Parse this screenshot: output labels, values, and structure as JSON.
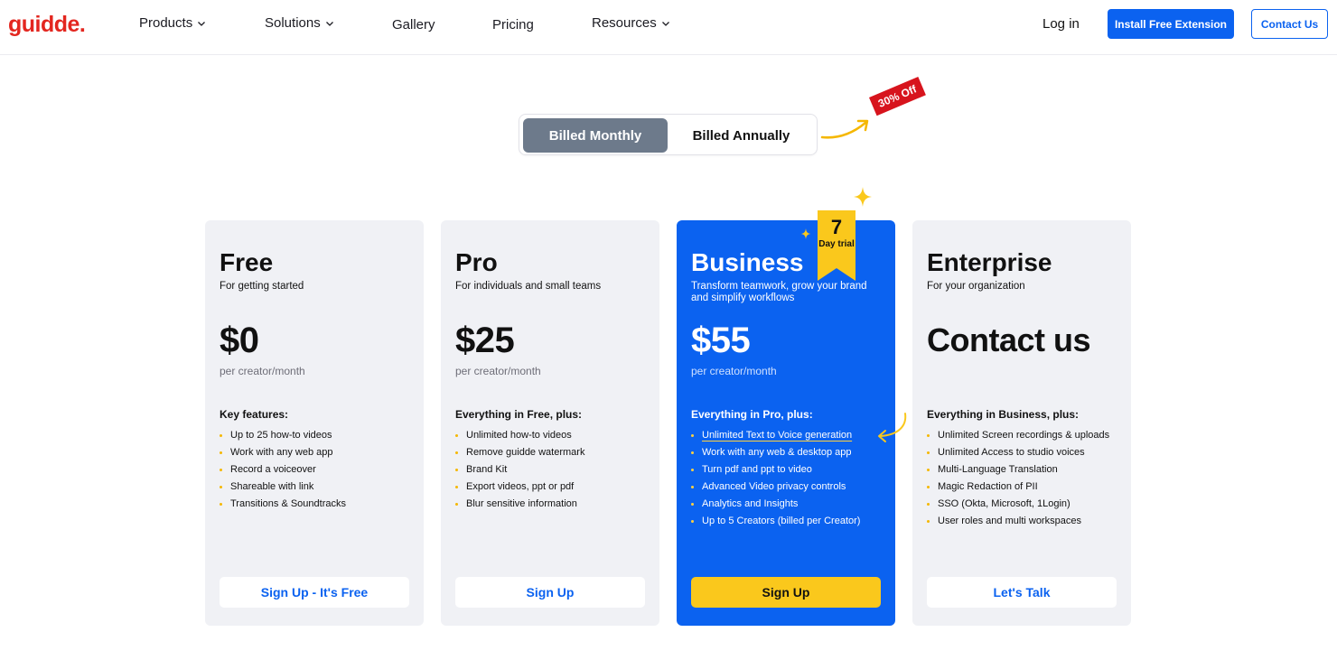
{
  "nav": {
    "logo": "guidde.",
    "items": [
      {
        "label": "Products",
        "dropdown": true
      },
      {
        "label": "Solutions",
        "dropdown": true
      },
      {
        "label": "Gallery",
        "dropdown": false
      },
      {
        "label": "Pricing",
        "dropdown": false
      },
      {
        "label": "Resources",
        "dropdown": true
      }
    ],
    "login": "Log in",
    "install": "Install Free Extension",
    "contact": "Contact Us"
  },
  "billing": {
    "monthly": "Billed Monthly",
    "annually": "Billed Annually",
    "selected": "monthly",
    "discount": "30% Off"
  },
  "plans": [
    {
      "name": "Free",
      "tagline": "For getting started",
      "price": "$0",
      "period": "per creator/month",
      "features_heading": "Key features:",
      "features": [
        "Up to 25 how-to videos",
        "Work with any web app",
        "Record a voiceover",
        "Shareable with link",
        "Transitions & Soundtracks"
      ],
      "cta": "Sign Up - It's Free"
    },
    {
      "name": "Pro",
      "tagline": "For individuals and small teams",
      "price": "$25",
      "period": "per creator/month",
      "features_heading": "Everything in Free, plus:",
      "features": [
        "Unlimited how-to videos",
        "Remove guidde watermark",
        "Brand Kit",
        "Export videos, ppt or pdf",
        "Blur sensitive information"
      ],
      "cta": "Sign Up"
    },
    {
      "name": "Business",
      "tagline": "Transform teamwork, grow your brand and simplify workflows",
      "price": "$55",
      "period": "per creator/month",
      "features_heading": "Everything in Pro, plus:",
      "features": [
        "Unlimited Text to Voice generation",
        "Work with any web & desktop app",
        "Turn pdf and ppt to video",
        "Advanced Video privacy controls",
        "Analytics and Insights",
        "Up to 5 Creators (billed per Creator)"
      ],
      "cta": "Sign Up",
      "trial_number": "7",
      "trial_label": "Day trial"
    },
    {
      "name": "Enterprise",
      "tagline": "For your organization",
      "price": "Contact us",
      "period": "",
      "features_heading": "Everything in Business, plus:",
      "features": [
        "Unlimited Screen recordings & uploads",
        "Unlimited Access to studio voices",
        "Multi-Language Translation",
        "Magic Redaction of PII",
        "SSO (Okta, Microsoft, 1Login)",
        "User roles and multi workspaces"
      ],
      "cta": "Let's Talk"
    }
  ],
  "colors": {
    "brand_red": "#e3261f",
    "primary_blue": "#0b62f0",
    "accent_yellow": "#fac81c",
    "toggle_active": "#6d7a8b",
    "card_bg": "#f0f1f5"
  }
}
